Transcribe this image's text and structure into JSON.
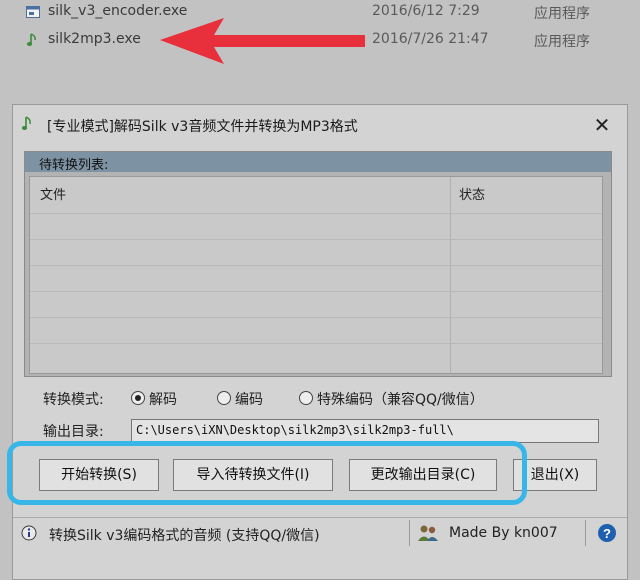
{
  "explorer": {
    "files": [
      {
        "name": "silk_v3_encoder.exe",
        "date": "2016/6/12 7:29",
        "type": "应用程序"
      },
      {
        "name": "silk2mp3.exe",
        "date": "2016/7/26 21:47",
        "type": "应用程序"
      }
    ]
  },
  "dialog": {
    "title": "[专业模式]解码Silk v3音频文件并转换为MP3格式",
    "list": {
      "header": "待转换列表:",
      "columns": [
        "文件",
        "状态"
      ]
    },
    "mode": {
      "label": "转换模式:",
      "options": [
        "解码",
        "编码",
        "特殊编码（兼容QQ/微信）"
      ],
      "selected": "解码"
    },
    "output": {
      "label": "输出目录:",
      "path": "C:\\Users\\iXN\\Desktop\\silk2mp3\\silk2mp3-full\\"
    },
    "buttons": {
      "start": "开始转换(S)",
      "import": "导入待转换文件(I)",
      "change_dir": "更改输出目录(C)",
      "exit": "退出(X)"
    },
    "status": {
      "info": "转换Silk v3编码格式的音频 (支持QQ/微信)",
      "credit": "Made By kn007"
    }
  },
  "colors": {
    "highlight": "#38b6e8",
    "arrow": "#e8303c",
    "list_header": "#7d93a4"
  }
}
